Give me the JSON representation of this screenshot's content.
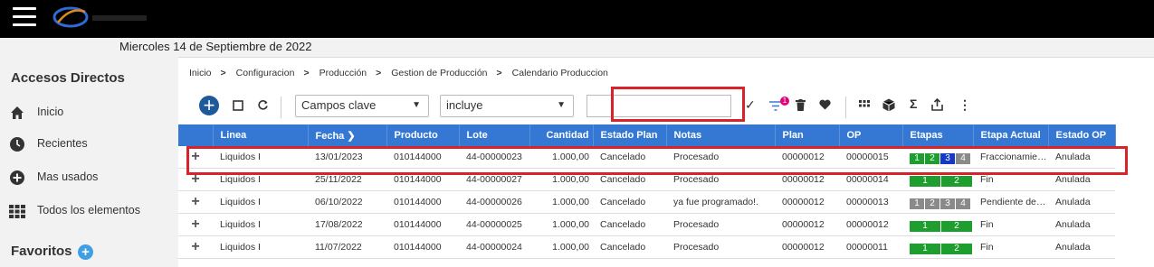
{
  "header": {
    "menu_icon": "hamburger-menu-icon",
    "logo": "company-logo"
  },
  "date_text": "Miercoles 14 de Septiembre de 2022",
  "sidebar": {
    "title": "Accesos Directos",
    "items": [
      {
        "label": "Inicio",
        "icon": "home-icon"
      },
      {
        "label": "Recientes",
        "icon": "clock-icon"
      },
      {
        "label": "Mas usados",
        "icon": "plus-circle-icon"
      },
      {
        "label": "Todos los elementos",
        "icon": "grid-icon"
      }
    ],
    "favorites_label": "Favoritos"
  },
  "breadcrumb": [
    "Inicio",
    "Configuracion",
    "Producción",
    "Gestion de Producción",
    "Calendario Produccion"
  ],
  "toolbar": {
    "field_select": "Campos clave",
    "operator_select": "incluye",
    "search_value": "",
    "filter_badge": "1"
  },
  "table": {
    "columns": [
      "Linea",
      "Fecha",
      "Producto",
      "Lote",
      "Cantidad",
      "Estado Plan",
      "Notas",
      "Plan",
      "OP",
      "Etapas",
      "Etapa Actual",
      "Estado OP"
    ],
    "rows": [
      {
        "linea": "Liquidos I",
        "fecha": "13/01/2023",
        "producto": "010144000",
        "lote": "44-00000023",
        "cantidad": "1.000,00",
        "estado_plan": "Cancelado",
        "notas": "Procesado",
        "plan": "00000012",
        "op": "00000015",
        "etapas": [
          "1",
          "2",
          "3",
          "4"
        ],
        "etapa_actual": "Fraccionamiento",
        "estado_op": "Anulada"
      },
      {
        "linea": "Liquidos I",
        "fecha": "25/11/2022",
        "producto": "010144000",
        "lote": "44-00000027",
        "cantidad": "1.000,00",
        "estado_plan": "Cancelado",
        "notas": "Procesado",
        "plan": "00000012",
        "op": "00000014",
        "etapas": [
          "1",
          "2"
        ],
        "etapa_actual": "Fin",
        "estado_op": "Anulada"
      },
      {
        "linea": "Liquidos I",
        "fecha": "06/10/2022",
        "producto": "010144000",
        "lote": "44-00000026",
        "cantidad": "1.000,00",
        "estado_plan": "Cancelado",
        "notas": "ya fue programado!.",
        "plan": "00000012",
        "op": "00000013",
        "etapas": [
          "1",
          "2",
          "3",
          "4"
        ],
        "etapa_actual": "Pendiente de Pesaje",
        "estado_op": "Anulada"
      },
      {
        "linea": "Liquidos I",
        "fecha": "17/08/2022",
        "producto": "010144000",
        "lote": "44-00000025",
        "cantidad": "1.000,00",
        "estado_plan": "Cancelado",
        "notas": "Procesado",
        "plan": "00000012",
        "op": "00000012",
        "etapas": [
          "1",
          "2"
        ],
        "etapa_actual": "Fin",
        "estado_op": "Anulada"
      },
      {
        "linea": "Liquidos I",
        "fecha": "11/07/2022",
        "producto": "010144000",
        "lote": "44-00000024",
        "cantidad": "1.000,00",
        "estado_plan": "Cancelado",
        "notas": "Procesado",
        "plan": "00000012",
        "op": "00000011",
        "etapas": [
          "1",
          "2"
        ],
        "etapa_actual": "Fin",
        "estado_op": "Anulada"
      }
    ]
  },
  "colors": {
    "header_blue": "#3578d3",
    "stage_green": "#1e9e2f",
    "stage_blue": "#1438c8",
    "stage_gray": "#8a8a8a",
    "highlight_red": "#d8232a"
  }
}
